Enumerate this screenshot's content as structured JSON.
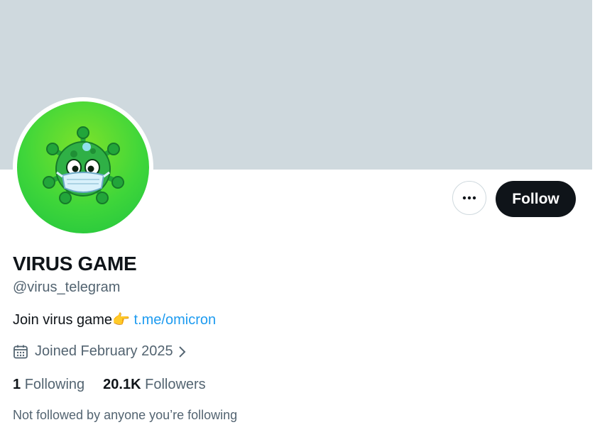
{
  "colors": {
    "banner": "#cfd9de",
    "follow_bg": "#0f1419",
    "link": "#1d9bf0",
    "muted_text": "#536471"
  },
  "profile": {
    "display_name": "VIRUS GAME",
    "handle": "@virus_telegram",
    "avatar_icon": "virus-mascot-with-mask-icon",
    "bio_text": "Join virus game",
    "bio_emoji": "👉",
    "bio_link": "t.me/omicron",
    "joined_icon": "calendar-icon",
    "joined": "Joined February 2025",
    "following_count": "1",
    "following_label": "Following",
    "followers_count": "20.1K",
    "followers_label": "Followers",
    "not_followed_note": "Not followed by anyone you’re following"
  },
  "actions": {
    "more_icon": "more-dots-icon",
    "follow_label": "Follow"
  }
}
